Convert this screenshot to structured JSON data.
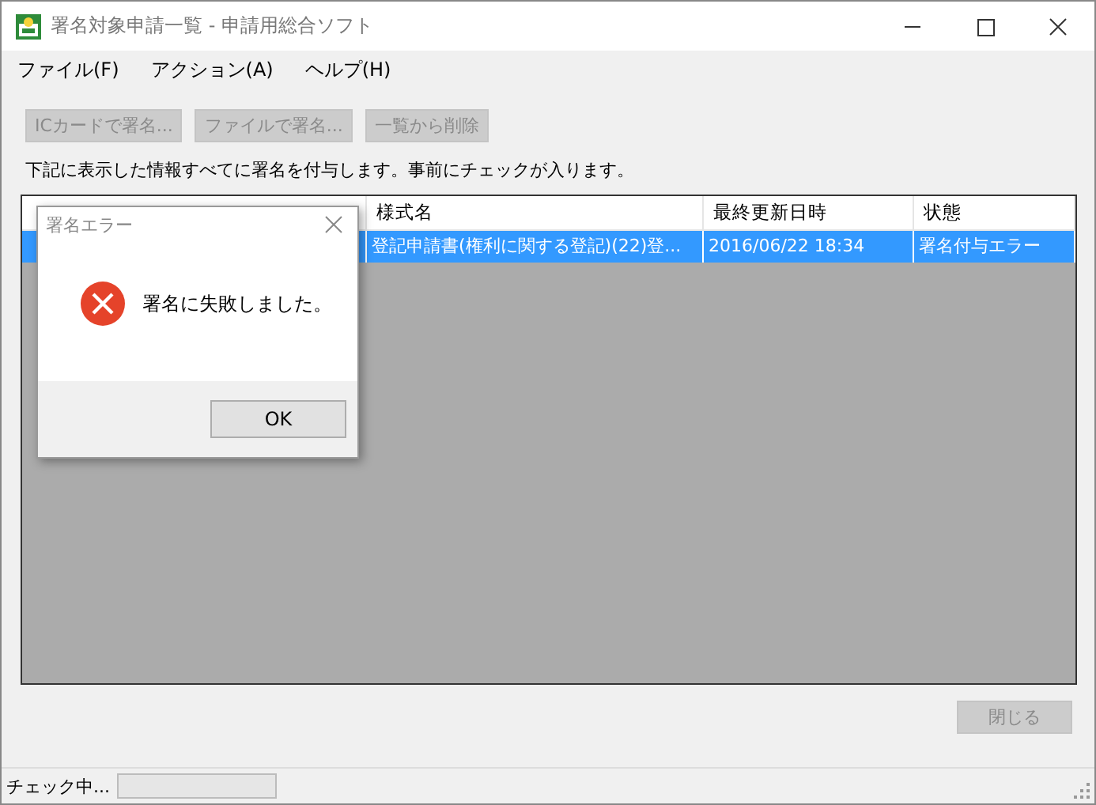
{
  "window": {
    "title": "署名対象申請一覧 - 申請用総合ソフト"
  },
  "menu": [
    {
      "label": "ファイル(F)"
    },
    {
      "label": "アクション(A)"
    },
    {
      "label": "ヘルプ(H)"
    }
  ],
  "toolbar": [
    {
      "label": "ICカードで署名...",
      "disabled": true
    },
    {
      "label": "ファイルで署名...",
      "disabled": true
    },
    {
      "label": "一覧から削除",
      "disabled": true
    }
  ],
  "description": "下記に表示した情報すべてに署名を付与します。事前にチェックが入ります。",
  "table": {
    "columns": [
      "様式名",
      "最終更新日時",
      "状態"
    ],
    "rows": [
      {
        "selected": true,
        "cells": [
          "登記申請書(権利に関する登記)(22)登...",
          "2016/06/22 18:34",
          "署名付与エラー"
        ]
      }
    ]
  },
  "close_button": {
    "label": "閉じる",
    "disabled": true
  },
  "status_bar": {
    "text": "チェック中...",
    "progress": {
      "level": 0
    }
  },
  "dialog": {
    "title": "署名エラー",
    "message": "署名に失敗しました。",
    "button": "OK"
  }
}
